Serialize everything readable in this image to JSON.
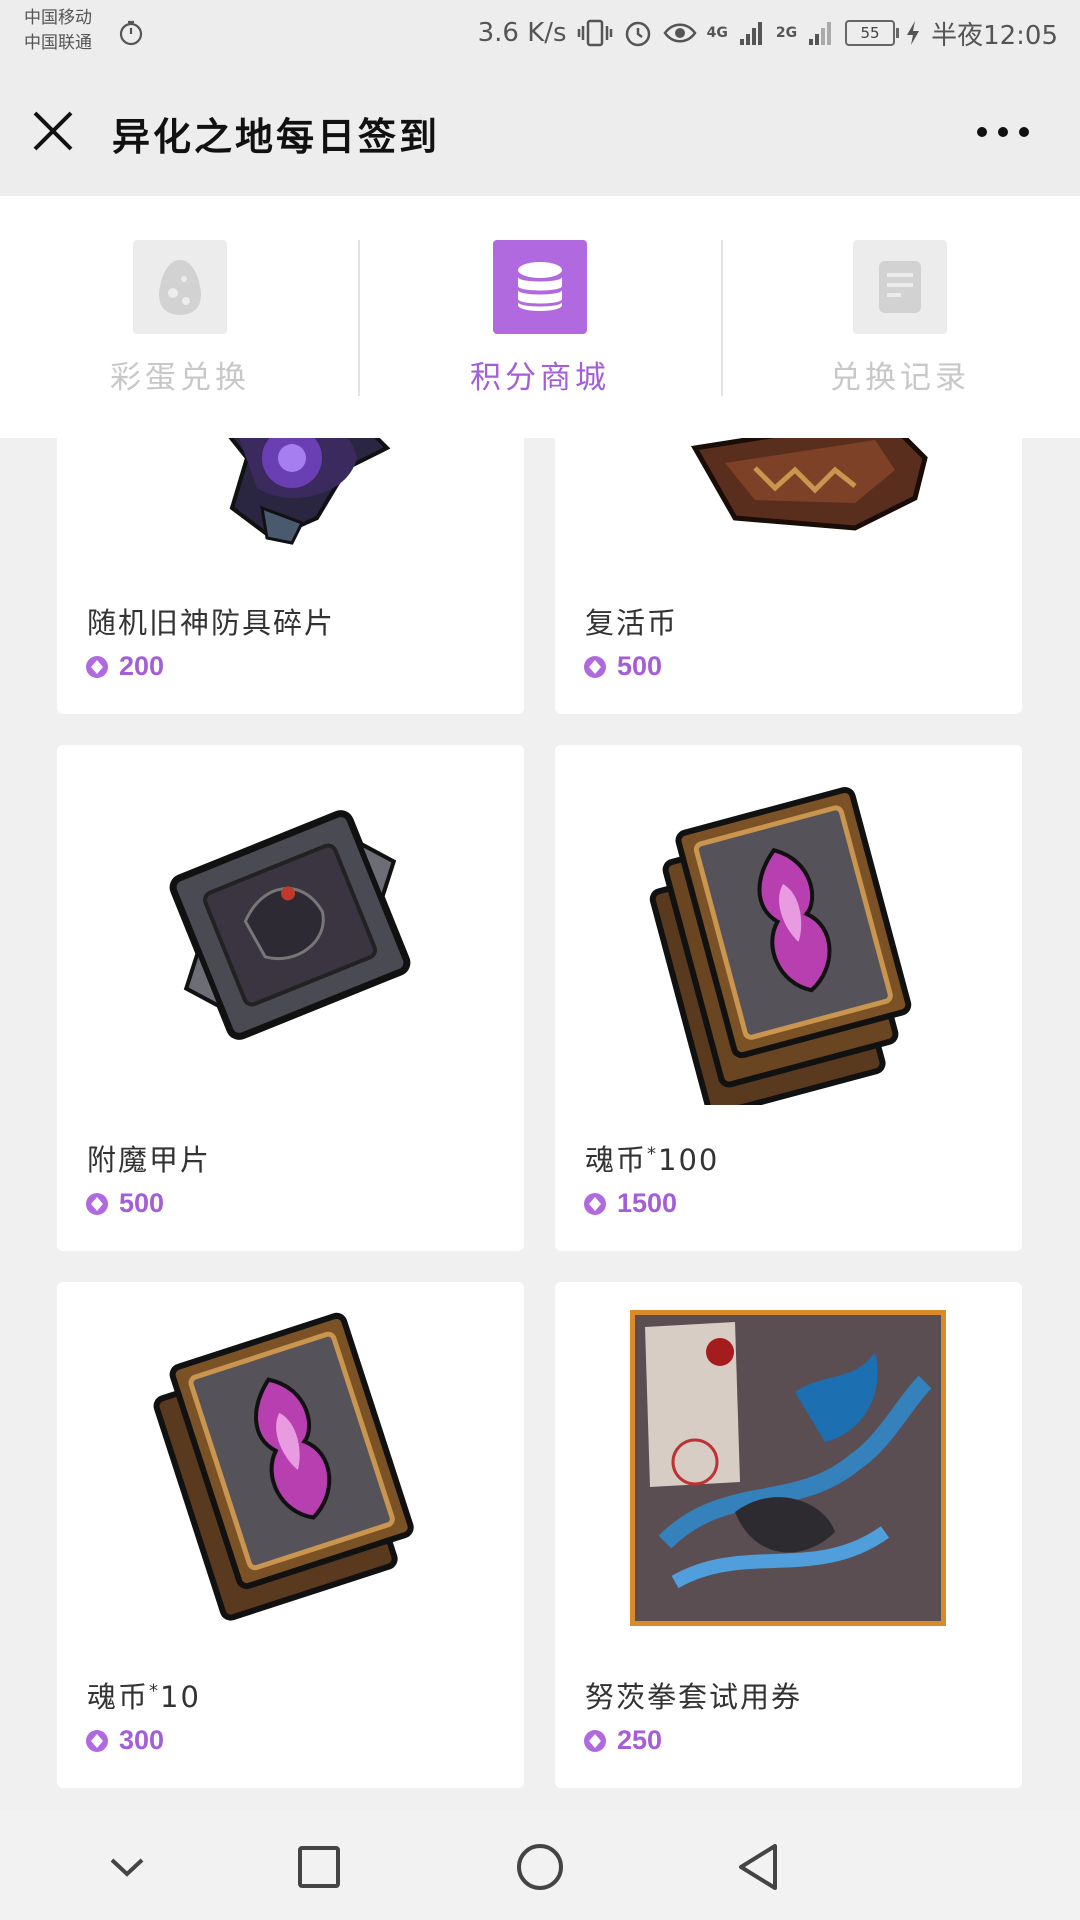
{
  "status_bar": {
    "carrier_1": "中国移动",
    "carrier_2": "中国联通",
    "speed": "3.6 K/s",
    "net_1": "4G",
    "net_2": "2G",
    "battery": "55",
    "time": "半夜12:05"
  },
  "header": {
    "title": "异化之地每日签到"
  },
  "tabs": [
    {
      "label": "彩蛋兑换",
      "icon": "egg-icon",
      "active": false
    },
    {
      "label": "积分商城",
      "icon": "database-icon",
      "active": true
    },
    {
      "label": "兑换记录",
      "icon": "document-icon",
      "active": false
    }
  ],
  "products": [
    {
      "name": "随机旧神防具碎片",
      "price": "200",
      "art": "armor-shard-art"
    },
    {
      "name": "复活币",
      "price": "500",
      "art": "revive-coin-art"
    },
    {
      "name": "附魔甲片",
      "price": "500",
      "art": "enchant-plate-art"
    },
    {
      "name_main": "魂币",
      "name_sup": "*",
      "name_qty": "100",
      "price": "1500",
      "art": "soul-cards-stack-art"
    },
    {
      "name_main": "魂币",
      "name_sup": "*",
      "name_qty": "10",
      "price": "300",
      "art": "soul-cards-pair-art"
    },
    {
      "name": "努茨拳套试用券",
      "price": "250",
      "art": "gauntlet-voucher-art"
    }
  ],
  "colors": {
    "accent": "#a45ed9",
    "icon_active_bg": "#b169e0",
    "inactive": "#c8c8c8"
  }
}
